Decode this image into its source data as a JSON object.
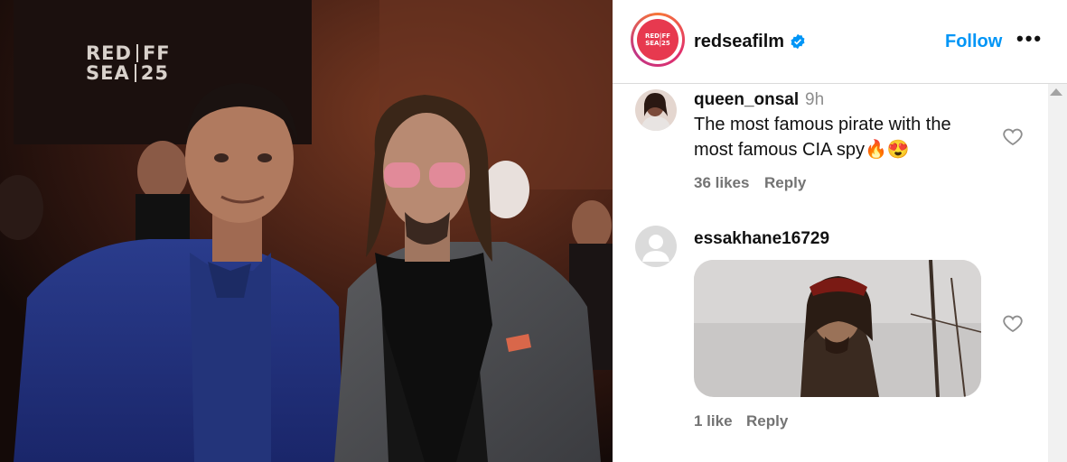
{
  "photo": {
    "watermark_lines": [
      "RED",
      "FF",
      "SEA",
      "25"
    ]
  },
  "post": {
    "username": "redseafilm",
    "avatar_text": [
      "RED",
      "FF",
      "SEA",
      "25"
    ],
    "follow_label": "Follow",
    "more_label": "•••"
  },
  "comments": [
    {
      "username": "queen_onsal",
      "time": "9h",
      "text": "The most famous pirate with the most famous CIA spy🔥😍",
      "likes": "36 likes",
      "reply_label": "Reply"
    },
    {
      "username": "essakhane16729",
      "has_gif": true,
      "likes": "1 like",
      "reply_label": "Reply"
    }
  ],
  "colors": {
    "accent": "#0095f6",
    "verified": "#0095f6",
    "brand": "#e7394f"
  },
  "icons": [
    "verified-badge-icon",
    "heart-icon",
    "more-icon",
    "scroll-up-icon",
    "default-avatar-icon"
  ]
}
